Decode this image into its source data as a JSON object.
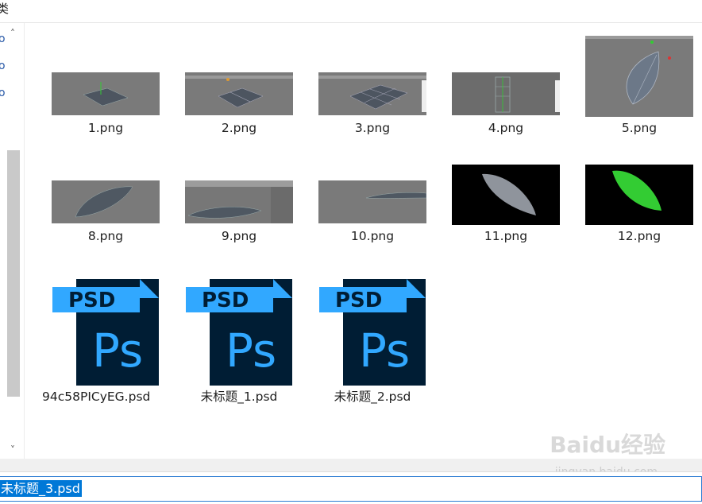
{
  "header": {
    "crumb": "类"
  },
  "nav": {
    "glyphs": [
      "o",
      "o",
      "o"
    ]
  },
  "files": [
    {
      "name": "1.png",
      "kind": "image"
    },
    {
      "name": "2.png",
      "kind": "image"
    },
    {
      "name": "3.png",
      "kind": "image"
    },
    {
      "name": "4.png",
      "kind": "image"
    },
    {
      "name": "5.png",
      "kind": "image"
    },
    {
      "name": "8.png",
      "kind": "image"
    },
    {
      "name": "9.png",
      "kind": "image"
    },
    {
      "name": "10.png",
      "kind": "image"
    },
    {
      "name": "11.png",
      "kind": "image"
    },
    {
      "name": "12.png",
      "kind": "image"
    },
    {
      "name": "94c58PICyEG.psd",
      "kind": "psd"
    },
    {
      "name": "未标题_1.psd",
      "kind": "psd"
    },
    {
      "name": "未标题_2.psd",
      "kind": "psd"
    }
  ],
  "psd_icon": {
    "tag": "PSD",
    "mark": "Ps",
    "tag_color": "#31a8ff",
    "body_color": "#001d34"
  },
  "filename": {
    "value": "未标题_3.psd"
  },
  "watermark": {
    "main": "Baidu经验",
    "sub": "jingyan.baidu.com"
  },
  "colors": {
    "selection": "#0078d7",
    "leaf_green": "#33cc33"
  }
}
